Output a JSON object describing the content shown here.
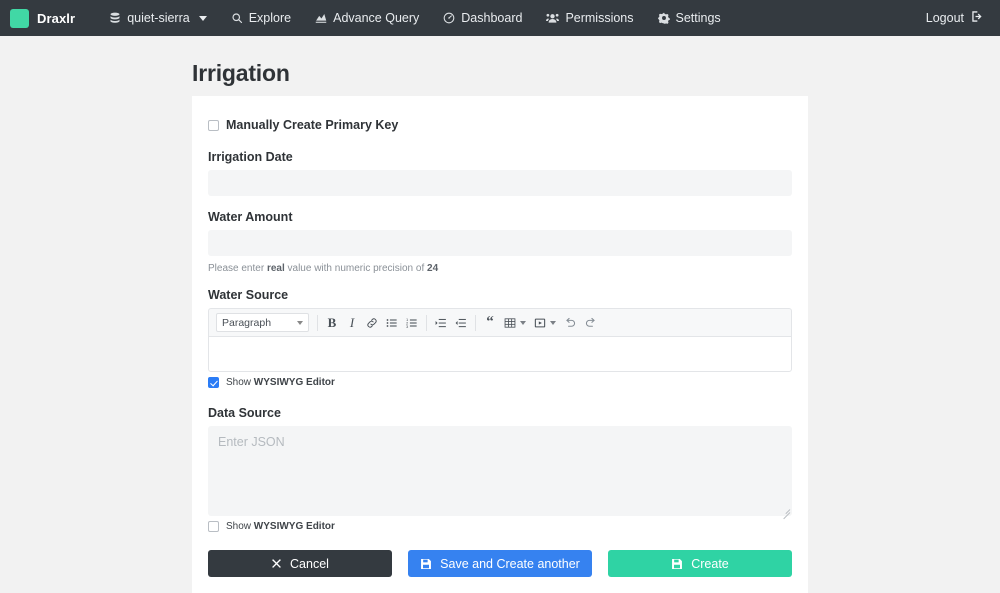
{
  "navbar": {
    "brand": "Draxlr",
    "brand_logo_color": "#41d8a5",
    "background_color": "#343a40",
    "db_selector": "quiet-sierra",
    "items": [
      {
        "label": "Explore",
        "icon": "search-icon"
      },
      {
        "label": "Advance Query",
        "icon": "chart-icon"
      },
      {
        "label": "Dashboard",
        "icon": "gauge-icon"
      },
      {
        "label": "Permissions",
        "icon": "users-icon"
      },
      {
        "label": "Settings",
        "icon": "gear-icon"
      }
    ],
    "logout": "Logout"
  },
  "page": {
    "title": "Irrigation"
  },
  "form": {
    "primary_key_checkbox": {
      "label": "Manually Create Primary Key",
      "checked": false
    },
    "fields": [
      {
        "label": "Irrigation Date",
        "value": "",
        "placeholder": ""
      },
      {
        "label": "Water Amount",
        "value": "",
        "placeholder": "",
        "help_prefix": "Please enter ",
        "help_type": "real",
        "help_middle": " value with numeric precision of ",
        "help_precision": "24"
      }
    ],
    "water_source": {
      "label": "Water Source",
      "editor": {
        "block_format": "Paragraph",
        "buttons": [
          {
            "name": "bold-icon",
            "glyph": "B"
          },
          {
            "name": "italic-icon",
            "glyph": "I"
          },
          {
            "name": "link-icon",
            "glyph": "link"
          },
          {
            "name": "bullet-list-icon",
            "glyph": "ul"
          },
          {
            "name": "numbered-list-icon",
            "glyph": "ol"
          },
          {
            "name": "indent-icon",
            "glyph": "indent"
          },
          {
            "name": "outdent-icon",
            "glyph": "outdent"
          },
          {
            "name": "blockquote-icon",
            "glyph": "“"
          },
          {
            "name": "table-icon",
            "glyph": "table"
          },
          {
            "name": "media-icon",
            "glyph": "media"
          },
          {
            "name": "undo-icon",
            "glyph": "undo"
          },
          {
            "name": "redo-icon",
            "glyph": "redo"
          }
        ],
        "content": ""
      },
      "wysiwyg_toggle": {
        "prefix": "Show ",
        "label": "WYSIWYG Editor",
        "checked": true
      }
    },
    "data_source": {
      "label": "Data Source",
      "value": "",
      "placeholder": "Enter JSON",
      "wysiwyg_toggle": {
        "prefix": "Show ",
        "label": "WYSIWYG Editor",
        "checked": false
      }
    },
    "actions": {
      "cancel": {
        "label": "Cancel",
        "icon": "close-icon",
        "color": "#343a40"
      },
      "save_another": {
        "label": "Save and Create another",
        "icon": "save-icon",
        "color": "#3682f0"
      },
      "create": {
        "label": "Create",
        "icon": "save-icon",
        "color": "#2fd3a4"
      }
    }
  }
}
